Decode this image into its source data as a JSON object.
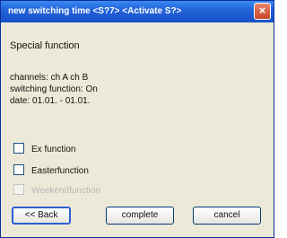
{
  "window": {
    "title": "new switching time <S?7> <Activate S?>",
    "close_glyph": "×"
  },
  "panel": {
    "section_label": "Special function",
    "channels": "channels: ch A ch B",
    "switching_function": "switching function: On",
    "date": "date: 01.01. - 01.01."
  },
  "options": [
    {
      "label": "Ex function",
      "checked": false,
      "enabled": true
    },
    {
      "label": "Easterfunction",
      "checked": false,
      "enabled": true
    },
    {
      "label": "Weekendfunction",
      "checked": false,
      "enabled": false
    }
  ],
  "buttons": {
    "back": "<< Back",
    "complete": "complete",
    "cancel": "cancel"
  },
  "colors": {
    "titlebar": "#2263d9",
    "close": "#c8452a",
    "background": "#ece9d8"
  },
  "icons": {
    "close": "close-icon",
    "checkbox": "checkbox-icon"
  }
}
